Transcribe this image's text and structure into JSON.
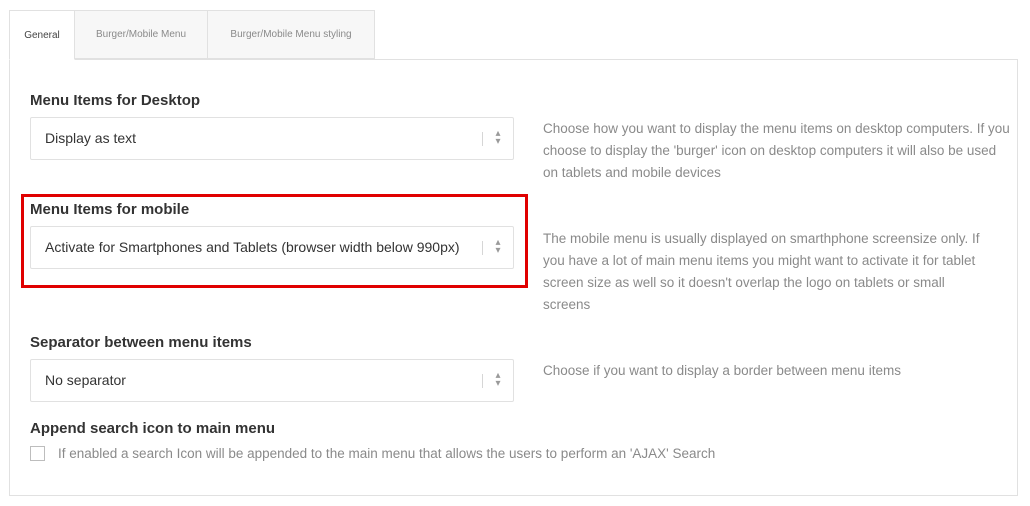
{
  "tabs": [
    {
      "label": "General",
      "active": true
    },
    {
      "label": "Burger/Mobile Menu",
      "active": false
    },
    {
      "label": "Burger/Mobile Menu styling",
      "active": false
    }
  ],
  "desktop": {
    "label": "Menu Items for Desktop",
    "value": "Display as text",
    "help": "Choose how you want to display the menu items on desktop computers. If you choose to display the 'burger' icon on desktop computers it will also be used on tablets and mobile devices"
  },
  "mobile": {
    "label": "Menu Items for mobile",
    "value": "Activate for Smartphones and Tablets (browser width below 990px)",
    "help": "The mobile menu is usually displayed on smarthphone screensize only. If you have a lot of main menu items you might want to activate it for tablet screen size as well so it doesn't overlap the logo on tablets or small screens"
  },
  "separator": {
    "label": "Separator between menu items",
    "value": "No separator",
    "help": "Choose if you want to display a border between menu items"
  },
  "search": {
    "label": "Append search icon to main menu",
    "checkbox_text": "If enabled a search Icon will be appended to the main menu that allows the users to perform an 'AJAX' Search",
    "checked": false
  },
  "icons": {
    "select_arrows": "⇕",
    "arrows_icon_name": "select-arrows-icon"
  },
  "colors": {
    "highlight": "#e00000",
    "help_text": "#8a8a8a",
    "border": "#e1e1e1"
  }
}
